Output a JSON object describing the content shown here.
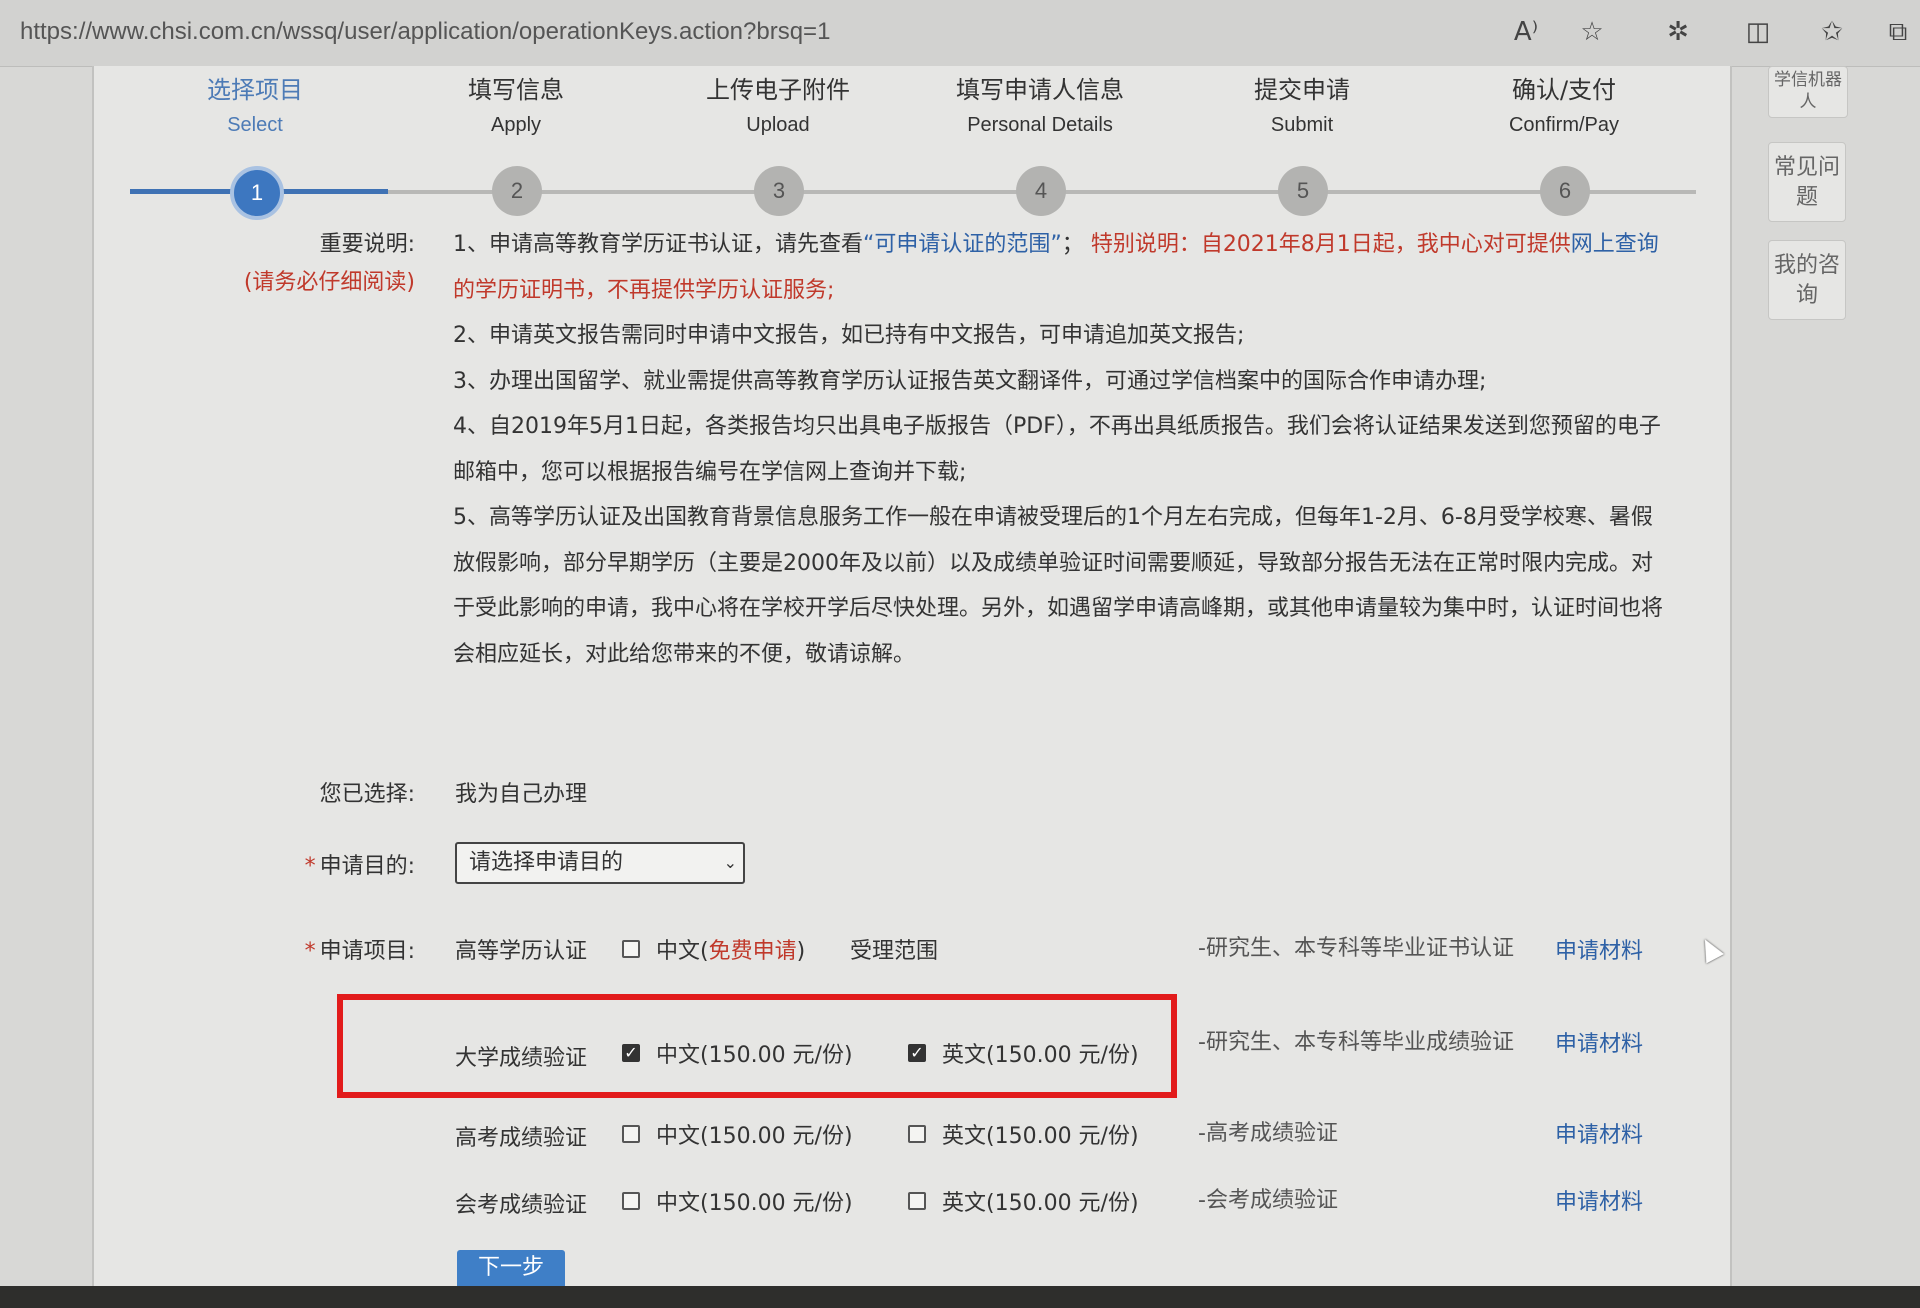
{
  "browser": {
    "url": "https://www.chsi.com.cn/wssq/user/application/operationKeys.action?brsq=1",
    "icons": [
      "read-aloud-icon",
      "favorite-star-icon",
      "extensions-icon",
      "split-screen-icon",
      "favorites-list-icon",
      "collections-icon"
    ]
  },
  "steps": [
    {
      "zh": "选择项目",
      "en": "Select",
      "num": "1",
      "active": true
    },
    {
      "zh": "填写信息",
      "en": "Apply",
      "num": "2",
      "active": false
    },
    {
      "zh": "上传电子附件",
      "en": "Upload",
      "num": "3",
      "active": false
    },
    {
      "zh": "填写申请人信息",
      "en": "Personal Details",
      "num": "4",
      "active": false
    },
    {
      "zh": "提交申请",
      "en": "Submit",
      "num": "5",
      "active": false
    },
    {
      "zh": "确认/支付",
      "en": "Confirm/Pay",
      "num": "6",
      "active": false
    }
  ],
  "side_widgets": {
    "robot": "学信机器人",
    "faq": "常见问题",
    "consult": "我的咨询"
  },
  "notes": {
    "label": "重要说明:",
    "sublabel": "(请务必仔细阅读)",
    "n1_prefix": "1、申请高等教育学历证书认证，请先查看",
    "n1_link": "“可申请认证的范围”",
    "n1_sep": "；",
    "n1_special": "特别说明：自2021年8月1日起，我中心对可提供",
    "n1_link2": "网上查询",
    "n1_tail": "的学历证明书，不再提供学历认证服务;",
    "n2": "2、申请英文报告需同时申请中文报告，如已持有中文报告，可申请追加英文报告;",
    "n3": "3、办理出国留学、就业需提供高等教育学历认证报告英文翻译件，可通过学信档案中的国际合作申请办理;",
    "n4": "4、自2019年5月1日起，各类报告均只出具电子版报告（PDF），不再出具纸质报告。我们会将认证结果发送到您预留的电子邮箱中，您可以根据报告编号在学信网上查询并下载;",
    "n5": "5、高等学历认证及出国教育背景信息服务工作一般在申请被受理后的1个月左右完成，但每年1-2月、6-8月受学校寒、暑假放假影响，部分早期学历（主要是2000年及以前）以及成绩单验证时间需要顺延，导致部分报告无法在正常时限内完成。对于受此影响的申请，我中心将在学校开学后尽快处理。另外，如遇留学申请高峰期，或其他申请量较为集中时，认证时间也将会相应延长，对此给您带来的不便，敬请谅解。"
  },
  "form": {
    "selected_label": "您已选择:",
    "selected_value": "我为自己办理",
    "purpose_label": "申请目的:",
    "purpose_value": "请选择申请目的",
    "items_label": "申请项目:",
    "required_mark": "*"
  },
  "items": [
    {
      "name": "高等学历认证",
      "opt1": "中文(",
      "opt1_free": "免费申请",
      "opt1_end": ")",
      "opt1_checked": false,
      "scope_link": "受理范围",
      "desc": "-研究生、本专科等毕业证书认证",
      "material": "申请材料"
    },
    {
      "name": "大学成绩验证",
      "opt1": "中文(150.00 元/份)",
      "opt1_checked": true,
      "opt2": "英文(150.00 元/份)",
      "opt2_checked": true,
      "desc": "-研究生、本专科等毕业成绩验证",
      "material": "申请材料"
    },
    {
      "name": "高考成绩验证",
      "opt1": "中文(150.00 元/份)",
      "opt1_checked": false,
      "opt2": "英文(150.00 元/份)",
      "opt2_checked": false,
      "desc": "-高考成绩验证",
      "material": "申请材料"
    },
    {
      "name": "会考成绩验证",
      "opt1": "中文(150.00 元/份)",
      "opt1_checked": false,
      "opt2": "英文(150.00 元/份)",
      "opt2_checked": false,
      "desc": "-会考成绩验证",
      "material": "申请材料"
    }
  ],
  "next_button": "下一步",
  "colors": {
    "accent": "#3d77c0",
    "highlight": "#e21b1b",
    "warning": "#c0392b"
  }
}
